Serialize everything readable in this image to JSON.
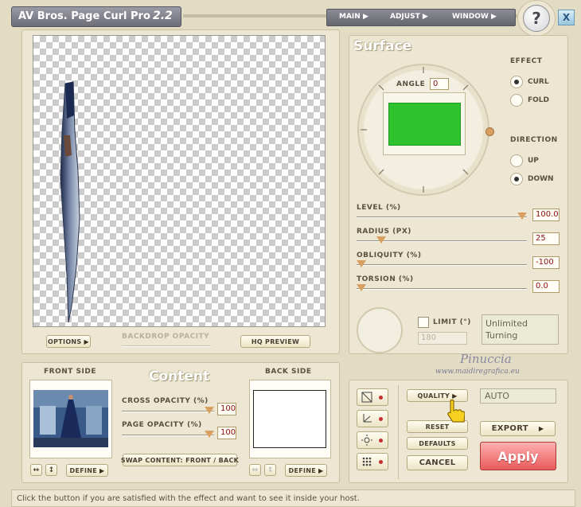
{
  "app": {
    "title": "AV Bros. Page Curl Pro",
    "version": "2.2"
  },
  "menu": {
    "items": [
      "MAIN",
      "ADJUST",
      "WINDOW"
    ],
    "help": "?",
    "close": "X"
  },
  "preview": {
    "options_label": "OPTIONS",
    "backdrop_label": "BACKDROP OPACITY",
    "hq_label": "HQ PREVIEW"
  },
  "surface": {
    "title": "Surface",
    "angle_label": "ANGLE",
    "angle_value": "0",
    "effect_label": "EFFECT",
    "effect_options": [
      "CURL",
      "FOLD"
    ],
    "effect_selected": "CURL",
    "direction_label": "DIRECTION",
    "direction_options": [
      "UP",
      "DOWN"
    ],
    "direction_selected": "DOWN",
    "level_label": "LEVEL (%)",
    "level_value": "100.0",
    "radius_label": "RADIUS (PX)",
    "radius_value": "25",
    "obliquity_label": "OBLIQUITY (%)",
    "obliquity_value": "-100",
    "torsion_label": "TORSION (%)",
    "torsion_value": "0.0",
    "limit_label": "LIMIT (°)",
    "limit_value": "180",
    "limit_status": "Unlimited Turning",
    "level_fraction": 1.0,
    "radius_fraction": 0.125,
    "obliquity_fraction": 0.0,
    "torsion_fraction": 0.0
  },
  "content": {
    "title": "Content",
    "front_label": "FRONT SIDE",
    "back_label": "BACK SIDE",
    "cross_opacity_label": "CROSS OPACITY (%)",
    "cross_opacity_value": "100",
    "page_opacity_label": "PAGE OPACITY (%)",
    "page_opacity_value": "100",
    "swap_label": "SWAP CONTENT: FRONT / BACK",
    "define_label": "DEFINE"
  },
  "watermark": {
    "name": "Pinuccia",
    "url": "www.maidiregrafica.eu"
  },
  "actions": {
    "quality_label": "QUALITY",
    "quality_value": "AUTO",
    "reset_label": "RESET",
    "defaults_label": "DEFAULTS",
    "cancel_label": "CANCEL",
    "export_label": "EXPORT",
    "apply_label": "Apply"
  },
  "status": {
    "text": "Click the button if you are satisfied with the effect and want to see it inside your host."
  },
  "colors": {
    "accent": "#d8a060",
    "apply": "#e85a5a",
    "preview_green": "#2fc42f",
    "value_text": "#8a1010"
  }
}
